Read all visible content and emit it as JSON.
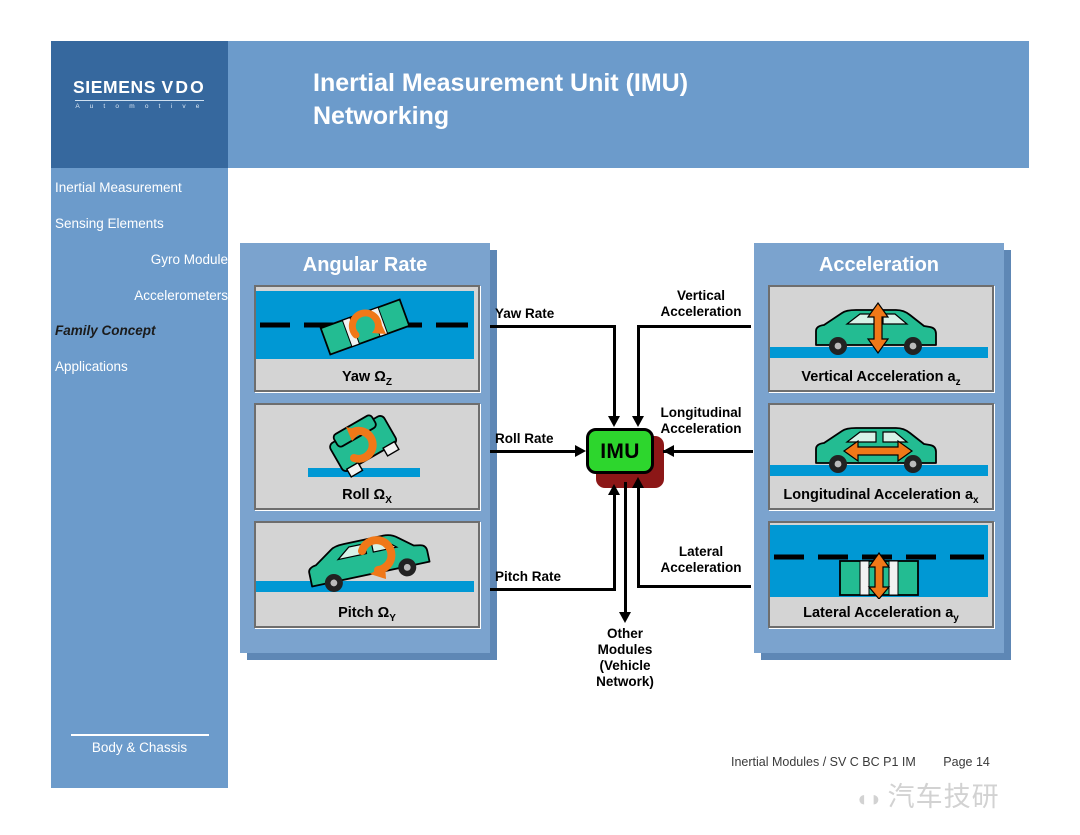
{
  "brand": {
    "name": "SIEMENS VDO",
    "name_main": "SIEMENS",
    "name_vdo": "VDO",
    "tagline": "A u t o m o t i v e"
  },
  "header": {
    "title_line1": "Inertial Measurement Unit (IMU)",
    "title_line2": "Networking",
    "bg_color": "#6C9BCB",
    "logo_bg_color": "#36689E"
  },
  "sidebar": {
    "items": [
      {
        "label": "Inertial Measurement",
        "level": 0,
        "active": false
      },
      {
        "label": "Sensing Elements",
        "level": 0,
        "active": false
      },
      {
        "label": "Gyro Module",
        "level": 1,
        "active": false
      },
      {
        "label": "Accelerometers",
        "level": 1,
        "active": false
      },
      {
        "label": "Family Concept",
        "level": 0,
        "active": true
      },
      {
        "label": "Applications",
        "level": 0,
        "active": false
      }
    ],
    "footer_label": "Body & Chassis"
  },
  "diagram": {
    "groups": [
      {
        "id": "angular-rate",
        "title": "Angular Rate"
      },
      {
        "id": "acceleration",
        "title": "Acceleration"
      }
    ],
    "angular_rate_cards": [
      {
        "id": "yaw",
        "caption": "Yaw ",
        "symbol": "Ω",
        "subscript": "Z",
        "view": "top-road"
      },
      {
        "id": "roll",
        "caption": "Roll ",
        "symbol": "Ω",
        "subscript": "X",
        "view": "rear-tilt"
      },
      {
        "id": "pitch",
        "caption": "Pitch ",
        "symbol": "Ω",
        "subscript": "Y",
        "view": "side-tilt"
      }
    ],
    "acceleration_cards": [
      {
        "id": "vertical",
        "caption": "Vertical Acceleration a",
        "subscript": "z",
        "view": "side-vertical-arrow"
      },
      {
        "id": "longitudinal",
        "caption": "Longitudinal Acceleration a",
        "subscript": "x",
        "view": "side-horizontal-arrow"
      },
      {
        "id": "lateral",
        "caption": "Lateral Acceleration a",
        "subscript": "y",
        "view": "top-lateral-arrow"
      }
    ],
    "center_node": {
      "label": "IMU",
      "color": "#2DD62D",
      "shadow_color": "#8C1717"
    },
    "input_labels": [
      {
        "id": "yaw-rate",
        "text": "Yaw Rate"
      },
      {
        "id": "roll-rate",
        "text": "Roll Rate"
      },
      {
        "id": "pitch-rate",
        "text": "Pitch Rate"
      }
    ],
    "output_labels": [
      {
        "id": "vertical-acceleration",
        "line1": "Vertical",
        "line2": "Acceleration"
      },
      {
        "id": "longitudinal-acceleration",
        "line1": "Longitudinal",
        "line2": "Acceleration"
      },
      {
        "id": "lateral-acceleration",
        "line1": "Lateral",
        "line2": "Acceleration"
      }
    ],
    "other_modules": {
      "line1": "Other",
      "line2": "Modules",
      "line3": "(Vehicle",
      "line4": "Network)"
    },
    "colors": {
      "panel_blue": "#7BA3CE",
      "panel_shadow": "#5E87B5",
      "card_gray": "#D4D4D4",
      "road_blue": "#0098D4",
      "car_green": "#23BC92",
      "arrow_orange": "#F07818"
    }
  },
  "footer": {
    "document": "Inertial Modules / SV C BC P1 IM",
    "page": "Page 14",
    "watermark": "汽车技研"
  }
}
